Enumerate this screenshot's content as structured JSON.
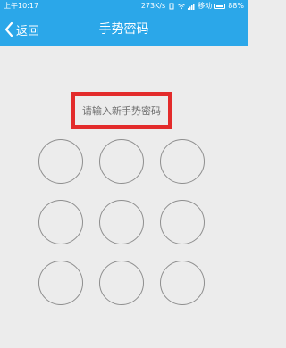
{
  "status_bar": {
    "time": "上午10:17",
    "net_speed": "273K/s",
    "carrier": "移动",
    "battery": "88%"
  },
  "nav": {
    "back_label": "返回",
    "title": "手势密码"
  },
  "prompt": {
    "text": "请输入新手势密码",
    "highlight_color": "#e32b2b"
  },
  "gesture_grid": {
    "rows": 3,
    "cols": 3
  },
  "colors": {
    "accent": "#2ba7e9",
    "background": "#ececec"
  }
}
